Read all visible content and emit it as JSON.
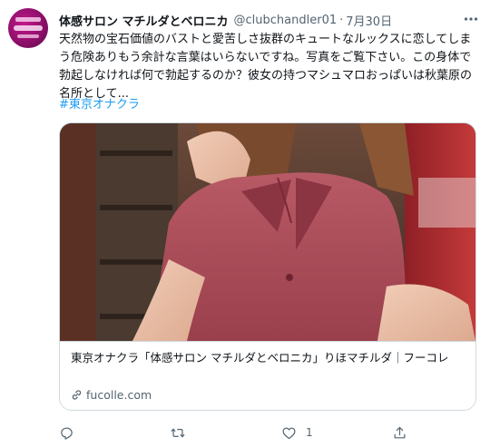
{
  "author": {
    "name": "体感サロン マチルダとベロニカ",
    "handle": "@clubchandler01",
    "separator": "·",
    "date": "7月30日"
  },
  "tweet": {
    "text": "天然物の宝石価値のバストと愛苦しさ抜群のキュートなルックスに恋してしまう危険ありもう余計な言葉はいらないですね。写真をご覧下さい。この身体で勃起しなければ何で勃起するのか？彼女の持つマシュマロおっぱいは秋葉原の名所として...",
    "hashtag": "#東京オナクラ"
  },
  "card": {
    "title": "東京オナクラ「体感サロン マチルダとベロニカ」りほマチルダ｜フーコレ",
    "domain": "fucolle.com"
  },
  "actions": {
    "reply_count": "",
    "retweet_count": "",
    "like_count": "1",
    "share_count": ""
  },
  "icons": {
    "more": "more-icon",
    "link": "link-icon",
    "reply": "reply-icon",
    "retweet": "retweet-icon",
    "like": "heart-icon",
    "share": "share-icon"
  },
  "colors": {
    "accent": "#1d9bf0",
    "muted": "#536471",
    "text": "#0f1419",
    "border": "#cfd9de",
    "avatar": "#a3127a"
  }
}
